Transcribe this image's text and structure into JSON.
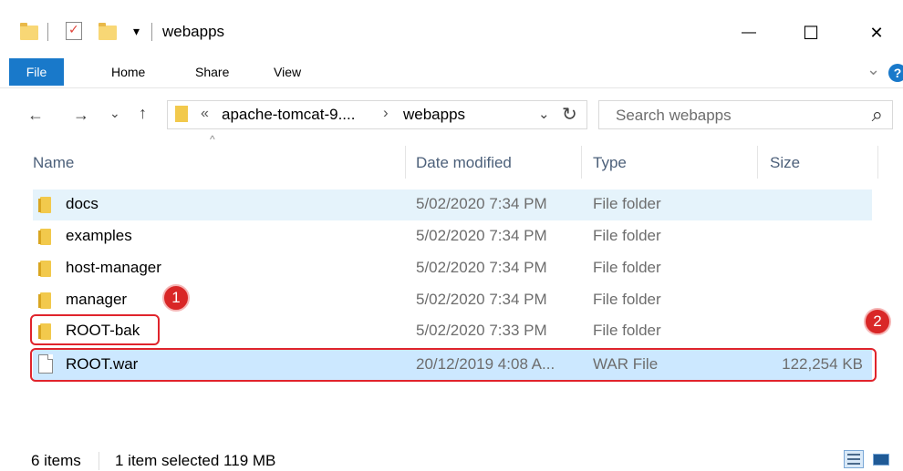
{
  "window": {
    "title": "webapps",
    "minimize": "—",
    "maximize": "☐",
    "close": "✕"
  },
  "quick_access": {
    "dropdown": "▾"
  },
  "ribbon": {
    "tabs": [
      "File",
      "Home",
      "Share",
      "View"
    ],
    "expand": "⌄",
    "help": "?"
  },
  "nav": {
    "back": "←",
    "forward": "→",
    "recent": "⌄",
    "up": "↑",
    "breadcrumb_overflow": "«",
    "path": [
      "apache-tomcat-9....",
      "webapps"
    ],
    "path_sep": "›",
    "dropdown": "⌄",
    "refresh": "↻",
    "search_placeholder": "Search webapps",
    "search_icon": "⌕"
  },
  "columns": {
    "name": "Name",
    "date": "Date modified",
    "type": "Type",
    "size": "Size",
    "sort_indicator": "^"
  },
  "files": [
    {
      "name": "docs",
      "date": "5/02/2020 7:34 PM",
      "type": "File folder",
      "size": "",
      "icon": "folder-icon"
    },
    {
      "name": "examples",
      "date": "5/02/2020 7:34 PM",
      "type": "File folder",
      "size": "",
      "icon": "folder-icon"
    },
    {
      "name": "host-manager",
      "date": "5/02/2020 7:34 PM",
      "type": "File folder",
      "size": "",
      "icon": "folder-icon"
    },
    {
      "name": "manager",
      "date": "5/02/2020 7:34 PM",
      "type": "File folder",
      "size": "",
      "icon": "folder-icon"
    },
    {
      "name": "ROOT-bak",
      "date": "5/02/2020 7:33 PM",
      "type": "File folder",
      "size": "",
      "icon": "folder-icon"
    },
    {
      "name": "ROOT.war",
      "date": "20/12/2019 4:08 A...",
      "type": "WAR File",
      "size": "122,254 KB",
      "icon": "file-icon"
    }
  ],
  "annotations": {
    "one": "1",
    "two": "2",
    "color": "#e0242c"
  },
  "status": {
    "items": "6 items",
    "selected": "1 item selected  119 MB"
  },
  "colors": {
    "accent": "#1979ca",
    "selected": "#cce8ff",
    "hover": "#e5f3fb",
    "folder": "#f2c94c"
  }
}
